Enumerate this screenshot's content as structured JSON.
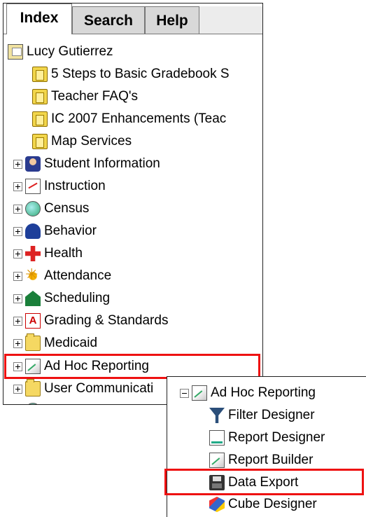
{
  "tabs": [
    {
      "label": "Index",
      "active": true
    },
    {
      "label": "Search",
      "active": false
    },
    {
      "label": "Help",
      "active": false
    }
  ],
  "tree": {
    "user": "Lucy Gutierrez",
    "books": [
      "5 Steps to Basic Gradebook S",
      "Teacher FAQ's",
      "IC 2007 Enhancements (Teac",
      "Map Services"
    ],
    "modules": [
      {
        "label": "Student Information",
        "icon": "student-icon"
      },
      {
        "label": "Instruction",
        "icon": "instruction-icon"
      },
      {
        "label": "Census",
        "icon": "census-icon"
      },
      {
        "label": "Behavior",
        "icon": "behavior-icon"
      },
      {
        "label": "Health",
        "icon": "health-icon"
      },
      {
        "label": "Attendance",
        "icon": "attendance-icon"
      },
      {
        "label": "Scheduling",
        "icon": "scheduling-icon"
      },
      {
        "label": "Grading & Standards",
        "icon": "grading-icon"
      },
      {
        "label": "Medicaid",
        "icon": "folder-icon"
      },
      {
        "label": "Ad Hoc Reporting",
        "icon": "adhoc-icon"
      },
      {
        "label": "User Communicati",
        "icon": "folder-icon"
      }
    ]
  },
  "popup": {
    "header": "Ad Hoc Reporting",
    "items": [
      {
        "label": "Filter Designer",
        "icon": "filter-icon"
      },
      {
        "label": "Report Designer",
        "icon": "report-designer-icon"
      },
      {
        "label": "Report Builder",
        "icon": "report-builder-icon"
      },
      {
        "label": "Data Export",
        "icon": "disk-icon"
      },
      {
        "label": "Cube Designer",
        "icon": "cube-icon"
      }
    ]
  },
  "colors": {
    "highlight": "#e11111"
  }
}
